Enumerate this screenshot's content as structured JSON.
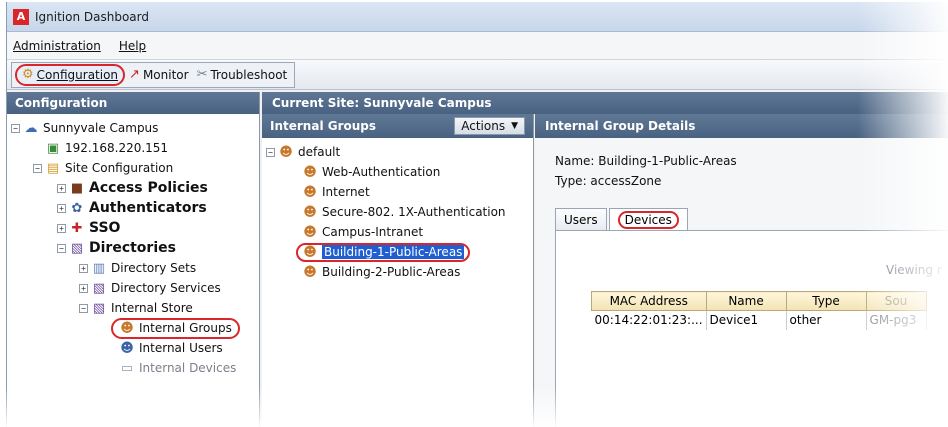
{
  "window": {
    "title": "Ignition Dashboard",
    "app_icon_letter": "A"
  },
  "menubar": {
    "items": [
      {
        "label": "Administration"
      },
      {
        "label": "Help"
      }
    ]
  },
  "toolbar": {
    "buttons": [
      {
        "label": "Configuration",
        "icon": "gear-icon",
        "active": true
      },
      {
        "label": "Monitor",
        "icon": "chart-icon",
        "active": false
      },
      {
        "label": "Troubleshoot",
        "icon": "tools-icon",
        "active": false
      }
    ]
  },
  "left_panel": {
    "header": "Configuration",
    "tree": [
      {
        "label": "Sunnyvale Campus",
        "icon": "campus-icon",
        "expander": "-",
        "level": 0,
        "style": "normal"
      },
      {
        "label": "192.168.220.151",
        "icon": "server-icon",
        "expander": "",
        "level": 1,
        "style": "normal"
      },
      {
        "label": "Site Configuration",
        "icon": "site-config-icon",
        "expander": "-",
        "level": 1,
        "style": "normal"
      },
      {
        "label": "Access Policies",
        "icon": "policy-icon",
        "expander": "+",
        "level": 2,
        "style": "big"
      },
      {
        "label": "Authenticators",
        "icon": "authenticators-icon",
        "expander": "+",
        "level": 2,
        "style": "big"
      },
      {
        "label": "SSO",
        "icon": "sso-icon",
        "expander": "+",
        "level": 2,
        "style": "big"
      },
      {
        "label": "Directories",
        "icon": "directories-icon",
        "expander": "-",
        "level": 2,
        "style": "big"
      },
      {
        "label": "Directory Sets",
        "icon": "directory-sets-icon",
        "expander": "+",
        "level": 3,
        "style": "normal"
      },
      {
        "label": "Directory Services",
        "icon": "directory-services-icon",
        "expander": "+",
        "level": 3,
        "style": "normal"
      },
      {
        "label": "Internal Store",
        "icon": "internal-store-icon",
        "expander": "-",
        "level": 3,
        "style": "normal"
      },
      {
        "label": "Internal Groups",
        "icon": "group-icon",
        "expander": "",
        "level": 4,
        "style": "selected"
      },
      {
        "label": "Internal Users",
        "icon": "user-icon",
        "expander": "",
        "level": 4,
        "style": "normal"
      },
      {
        "label": "Internal Devices",
        "icon": "device-icon",
        "expander": "",
        "level": 4,
        "style": "grey"
      }
    ]
  },
  "site": {
    "header": "Current Site:  Sunnyvale Campus"
  },
  "groups_panel": {
    "header": "Internal Groups",
    "actions_label": "Actions",
    "root": "default",
    "items": [
      {
        "label": "Web-Authentication",
        "selected": false
      },
      {
        "label": "Internet",
        "selected": false
      },
      {
        "label": "Secure-802. 1X-Authentication",
        "selected": false
      },
      {
        "label": "Campus-Intranet",
        "selected": false
      },
      {
        "label": "Building-1-Public-Areas",
        "selected": true
      },
      {
        "label": "Building-2-Public-Areas",
        "selected": false
      }
    ]
  },
  "details": {
    "header": "Internal Group Details",
    "name_line": "Name: Building-1-Public-Areas",
    "type_line": "Type:  accessZone",
    "tabs": [
      {
        "label": "Users",
        "active": false
      },
      {
        "label": "Devices",
        "active": true
      }
    ],
    "viewing_text": "Viewing r",
    "table": {
      "columns": [
        "MAC Address",
        "Name",
        "Type",
        "Sou"
      ],
      "rows": [
        [
          "00:14:22:01:23:...",
          "Device1",
          "other",
          "GM-pg3"
        ]
      ]
    }
  },
  "colors": {
    "panel_header": "#4a6282",
    "highlight": "#d9262b",
    "selection": "#1f5fd1"
  }
}
